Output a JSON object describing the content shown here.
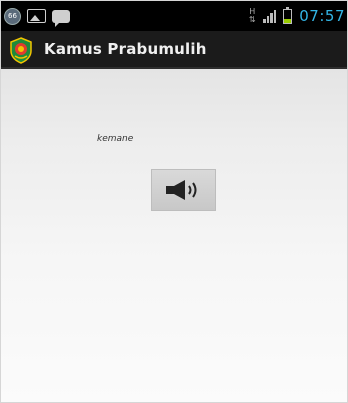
{
  "status_bar": {
    "notification_badge": "66",
    "network_type": "H",
    "time": "07:57",
    "time_color": "#33b5e5",
    "battery_level": 0.3,
    "battery_color": "#99cc00",
    "icons": [
      "notification-count-icon",
      "image-icon",
      "chat-icon",
      "signal-icon",
      "battery-icon"
    ]
  },
  "action_bar": {
    "app_title": "Kamus Prabumulih",
    "logo_icon": "prabumulih-crest-icon"
  },
  "content": {
    "word": "kemane",
    "audio_button_icon": "speaker-sound-icon"
  }
}
